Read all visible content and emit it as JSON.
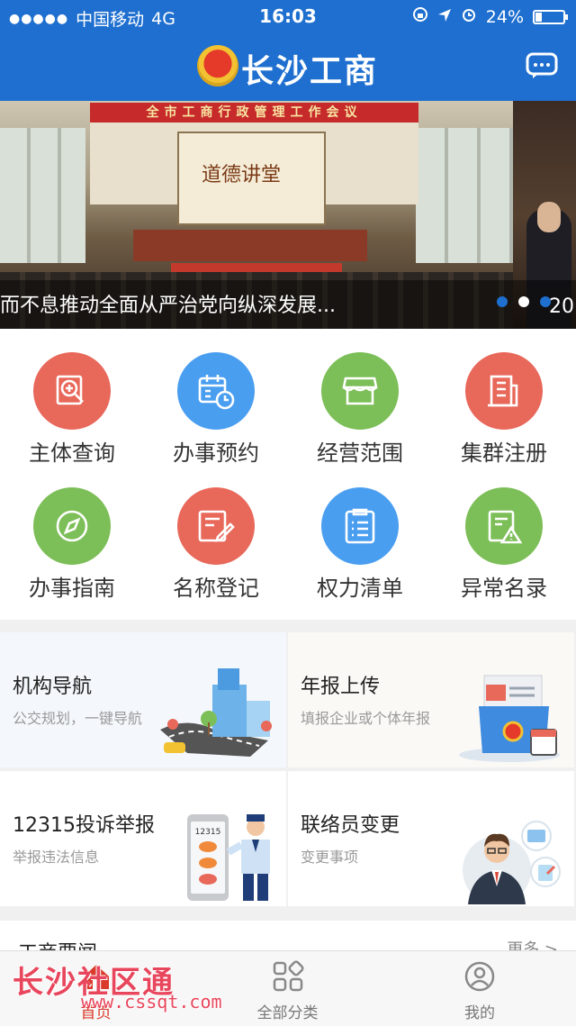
{
  "status_bar": {
    "signal": "●●●●●",
    "carrier": "中国移动",
    "network": "4G",
    "time": "16:03",
    "battery": "24%",
    "battery_level": 0.24
  },
  "header": {
    "title": "长沙工商"
  },
  "banner": {
    "hall_text": "全市工商行政管理工作会议",
    "screen_text": "道德讲堂",
    "caption": "而不息推动全面从严治党向纵深发展...",
    "next_caption": "20",
    "page_count": 3,
    "active_index": 1
  },
  "services": [
    {
      "label": "主体查询",
      "icon": "magnifier-document-icon",
      "color": "#e8685a"
    },
    {
      "label": "办事预约",
      "icon": "calendar-clock-icon",
      "color": "#4a9ef0"
    },
    {
      "label": "经营范围",
      "icon": "storefront-icon",
      "color": "#7cbe57"
    },
    {
      "label": "集群注册",
      "icon": "building-icon",
      "color": "#e8685a"
    },
    {
      "label": "办事指南",
      "icon": "compass-icon",
      "color": "#7cbe57"
    },
    {
      "label": "名称登记",
      "icon": "edit-document-icon",
      "color": "#e8685a"
    },
    {
      "label": "权力清单",
      "icon": "checklist-icon",
      "color": "#4a9ef0"
    },
    {
      "label": "异常名录",
      "icon": "warning-document-icon",
      "color": "#7cbe57"
    }
  ],
  "cards": [
    {
      "title": "机构导航",
      "subtitle": "公交规划，一键导航",
      "icon": "map-navigation-icon"
    },
    {
      "title": "年报上传",
      "subtitle": "填报企业或个体年报",
      "icon": "folder-report-icon"
    },
    {
      "title": "12315投诉举报",
      "subtitle": "举报违法信息",
      "icon": "phone-officer-icon",
      "phone_text": "12315"
    },
    {
      "title": "联络员变更",
      "subtitle": "变更事项",
      "icon": "contact-person-icon"
    }
  ],
  "news": {
    "title": "工商要闻",
    "more": "更多 >"
  },
  "tabs": [
    {
      "label": "首页",
      "icon": "home-icon",
      "active": true
    },
    {
      "label": "全部分类",
      "icon": "grid-categories-icon",
      "active": false
    },
    {
      "label": "我的",
      "icon": "user-profile-icon",
      "active": false
    }
  ],
  "watermark": {
    "text": "长沙社区通",
    "url": "www.cssqt.com"
  },
  "colors": {
    "brand_blue": "#1e6fcf",
    "red": "#e8685a",
    "blue": "#4a9ef0",
    "green": "#7cbe57",
    "active_tab": "#d93a2a"
  }
}
